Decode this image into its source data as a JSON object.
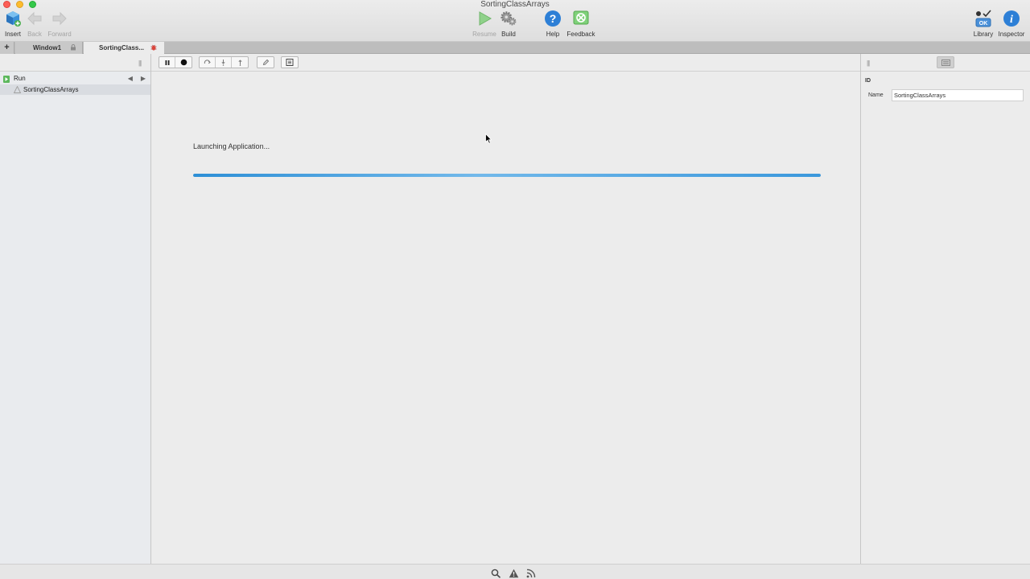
{
  "window": {
    "title": "SortingClassArrays"
  },
  "toolbar": {
    "insert": "Insert",
    "back": "Back",
    "forward": "Forward",
    "resume": "Resume",
    "build": "Build",
    "help": "Help",
    "feedback": "Feedback",
    "library": "Library",
    "inspector": "Inspector"
  },
  "tabs": {
    "add": "+",
    "items": [
      {
        "label": "Window1",
        "active": false
      },
      {
        "label": "SortingClass...",
        "active": true
      }
    ]
  },
  "sidebar": {
    "run_label": "Run",
    "items": [
      {
        "label": "SortingClassArrays"
      }
    ]
  },
  "main": {
    "status_text": "Launching Application...",
    "progress": 1.0
  },
  "inspector": {
    "section": "ID",
    "name_label": "Name",
    "name_value": "SortingClassArrays"
  },
  "colors": {
    "accent": "#2d8fd6",
    "run_green": "#5cb85c",
    "feedback_green": "#55c04a",
    "help_blue": "#2d7fd6"
  },
  "icons": {
    "insert": "cube-add-icon",
    "back": "arrow-left-icon",
    "forward": "arrow-right-icon",
    "resume": "play-icon",
    "build": "gears-icon",
    "help": "question-circle-icon",
    "feedback": "feedback-icon",
    "library": "library-icon",
    "inspector": "info-circle-icon"
  }
}
